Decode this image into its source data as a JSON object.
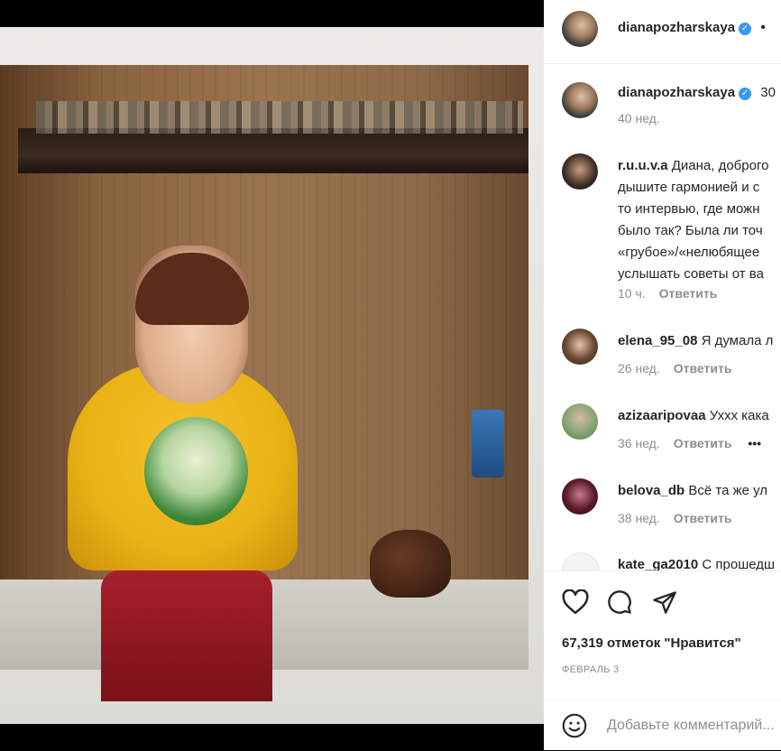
{
  "post": {
    "author": "dianapozharskaya",
    "separator": "•",
    "likes": "67,319 отметок \"Нравится\"",
    "date": "ФЕВРАЛЬ 3"
  },
  "caption": {
    "username": "dianapozharskaya",
    "text": "30",
    "time": "40 нед."
  },
  "comments": [
    {
      "username": "r.u.u.v.a",
      "lines": [
        "Диана, доброго",
        "дышите гармонией и с",
        "то интервью, где можн",
        "было так? Была ли точ",
        "«грубое»/«нелюбящее",
        "услышать советы от ва"
      ],
      "time": "10 ч.",
      "reply": "Ответить"
    },
    {
      "username": "elena_95_08",
      "text": "Я думала л",
      "time": "26 нед.",
      "reply": "Ответить"
    },
    {
      "username": "azizaaripovaa",
      "text": "Ухxx кака",
      "time": "36 нед.",
      "reply": "Ответить",
      "more": "•••"
    },
    {
      "username": "belova_db",
      "text": "Всё та же ул",
      "time": "38 нед.",
      "reply": "Ответить"
    },
    {
      "username": "kate_ga2010",
      "text": "С прошедш"
    }
  ],
  "add_comment": {
    "placeholder": "Добавьте комментарий..."
  },
  "colors": {
    "verified": "#3897f0",
    "meta": "#8e8e8e"
  },
  "icons": [
    "heart-icon",
    "comment-icon",
    "share-icon",
    "emoji-icon",
    "verified-icon"
  ]
}
